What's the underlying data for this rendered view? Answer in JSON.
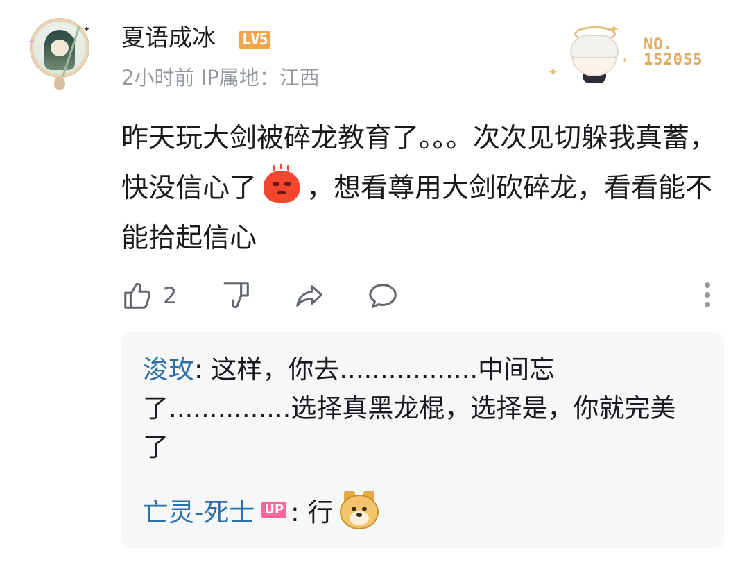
{
  "comment": {
    "username": "夏语成冰",
    "level": "LV5",
    "meta": "2小时前 IP属地：江西",
    "fan_number": "NO.\n152055",
    "content_part1": "昨天玩大剑被碎龙教育了。。。次次见切躲我真蓄，快没信心了",
    "content_part2": "，想看尊用大剑砍碎龙，看看能不能拾起信心",
    "likes": "2"
  },
  "replies": [
    {
      "name": "浚玫",
      "text": ": 这样，你去.................中间忘了...............选择真黑龙棍，选择是，你就完美了"
    },
    {
      "name": "亡灵-死士",
      "badge": "UP",
      "text": ": 行"
    }
  ],
  "icons": {
    "like": "thumbs-up-icon",
    "dislike": "thumbs-down-icon",
    "share": "share-icon",
    "reply": "comment-icon",
    "more": "more-vertical-icon"
  },
  "colors": {
    "reply_name": "#2d6fa8",
    "level_badge": "#f7a54a",
    "up_badge": "#ff6699",
    "fan_label": "#e0a95f"
  }
}
